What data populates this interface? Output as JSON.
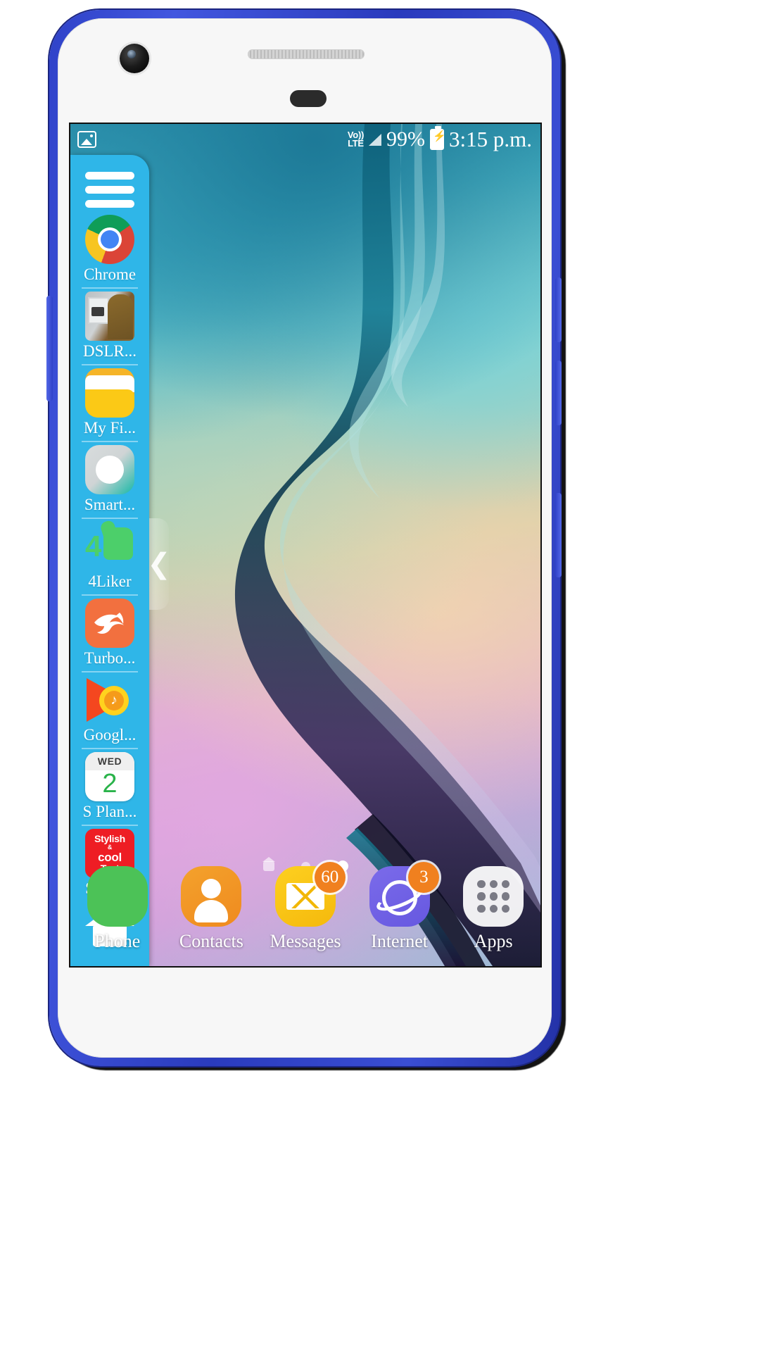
{
  "device": {
    "frame_color": "#2f42c8",
    "body_color": "#f7f7f7"
  },
  "status_bar": {
    "gallery_icon": "gallery-icon",
    "network_line1": "Vo))",
    "network_line2": "LTE",
    "signal_icon": "signal-bars-icon",
    "battery_percent": "99%",
    "battery_icon": "battery-charging-icon",
    "time": "3:15 p.m."
  },
  "edge_panel": {
    "background_color": "#2fb6e8",
    "menu_icon": "hamburger-menu-icon",
    "handle_icon": "chevron-left-icon",
    "handle_glyph": "❮",
    "apps": [
      {
        "name": "chrome",
        "label": "Chrome",
        "icon": "chrome-icon"
      },
      {
        "name": "dslr-camera",
        "label": "DSLR...",
        "icon": "dslr-camera-icon"
      },
      {
        "name": "my-files",
        "label": "My Fi...",
        "icon": "folder-icon"
      },
      {
        "name": "smart-switch",
        "label": "Smart...",
        "icon": "smart-switch-icon"
      },
      {
        "name": "4liker",
        "label": "4Liker",
        "icon": "thumbs-up-icon",
        "glyph": "4"
      },
      {
        "name": "turbo-browser",
        "label": "Turbo...",
        "icon": "turbo-bird-icon"
      },
      {
        "name": "google-play-music",
        "label": "Googl...",
        "icon": "play-music-icon",
        "glyph": "♪"
      },
      {
        "name": "s-planner",
        "label": "S Plan...",
        "icon": "calendar-icon",
        "weekday": "WED",
        "day": "2"
      },
      {
        "name": "stylish-text",
        "label": "Stylis...",
        "icon": "stylish-text-icon",
        "line1": "Stylish",
        "line2": "&",
        "line3": "cool",
        "line4": "Text"
      }
    ],
    "home_button": {
      "label": "",
      "icon": "home-icon"
    }
  },
  "page_indicator": {
    "dots": [
      {
        "type": "home",
        "active": false
      },
      {
        "type": "dot",
        "active": false
      },
      {
        "type": "dot",
        "active": true
      }
    ]
  },
  "dock": {
    "items": [
      {
        "name": "phone",
        "label": "Phone",
        "icon": "phone-icon",
        "badge": ""
      },
      {
        "name": "contacts",
        "label": "Contacts",
        "icon": "contacts-icon",
        "badge": ""
      },
      {
        "name": "messages",
        "label": "Messages",
        "icon": "message-envelope-icon",
        "badge": "60"
      },
      {
        "name": "internet",
        "label": "Internet",
        "icon": "internet-planet-icon",
        "badge": "3"
      },
      {
        "name": "apps",
        "label": "Apps",
        "icon": "apps-grid-icon",
        "badge": ""
      }
    ]
  },
  "colors": {
    "accent": "#2fb6e8",
    "badge": "#f0801f",
    "contacts": "#f09a25",
    "messages": "#fdd020",
    "internet": "#6e5fe6"
  }
}
